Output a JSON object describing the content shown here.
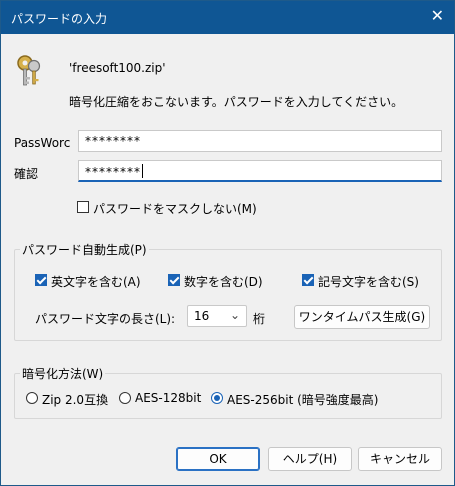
{
  "window": {
    "title": "パスワードの入力",
    "close_glyph": "✕"
  },
  "header": {
    "filename": "'freesoft100.zip'",
    "message": "暗号化圧縮をおこないます。パスワードを入力してください。"
  },
  "fields": {
    "password_label": "PassWorc",
    "password_value": "********",
    "confirm_label": "確認",
    "confirm_value": "********"
  },
  "mask_checkbox": {
    "label": "パスワードをマスクしない(M)",
    "checked": false
  },
  "autogen": {
    "legend": "パスワード自動生成(P)",
    "options": [
      {
        "label": "英文字を含む(A)",
        "checked": true
      },
      {
        "label": "数字を含む(D)",
        "checked": true
      },
      {
        "label": "記号文字を含む(S)",
        "checked": true
      }
    ],
    "length_label": "パスワード文字の長さ(L):",
    "length_value": "16",
    "length_unit": "桁",
    "onetime_button": "ワンタイムパス生成(G)"
  },
  "encryption": {
    "legend": "暗号化方法(W)",
    "options": [
      {
        "label": "Zip 2.0互換",
        "selected": false
      },
      {
        "label": "AES-128bit",
        "selected": false
      },
      {
        "label": "AES-256bit (暗号強度最高)",
        "selected": true
      }
    ]
  },
  "buttons": {
    "ok": "OK",
    "help": "ヘルプ(H)",
    "cancel": "キャンセル"
  }
}
